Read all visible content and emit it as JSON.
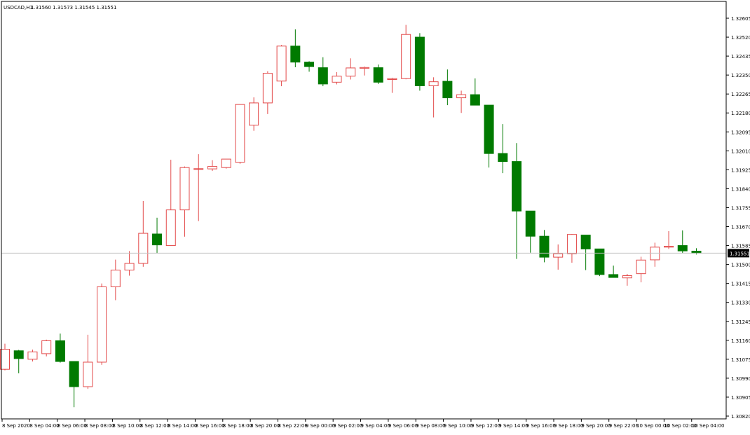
{
  "header": {
    "symbol_timeframe": "USDCAD,H1",
    "ohlc": "1.31560 1.31573 1.31545 1.31551"
  },
  "current_price_label": "1.31551",
  "colors": {
    "bull_outline": "#e34a4a",
    "bear_fill": "#007a00",
    "axis": "#000000",
    "price_line": "#c0c0c0",
    "price_label_bg": "#000000",
    "price_label_text": "#ffffff"
  },
  "chart_data": {
    "type": "candlestick",
    "title": "USDCAD,H1",
    "ylim": [
      1.3082,
      1.26605
    ],
    "y_ticks": [
      "1.32605",
      "1.32520",
      "1.32435",
      "1.32350",
      "1.32265",
      "1.32180",
      "1.32095",
      "1.32010",
      "1.31925",
      "1.31840",
      "1.31755",
      "1.31670",
      "1.31585",
      "1.31500",
      "1.31415",
      "1.31330",
      "1.31245",
      "1.31160",
      "1.31075",
      "1.30990",
      "1.30905",
      "1.30820"
    ],
    "x_ticks": [
      "8 Sep 2020",
      "8 Sep 04:00",
      "8 Sep 06:00",
      "8 Sep 08:00",
      "8 Sep 10:00",
      "8 Sep 12:00",
      "8 Sep 14:00",
      "8 Sep 16:00",
      "8 Sep 18:00",
      "8 Sep 20:00",
      "8 Sep 22:06",
      "9 Sep 00:00",
      "9 Sep 02:00",
      "9 Sep 04:00",
      "9 Sep 06:00",
      "9 Sep 08:00",
      "9 Sep 10:00",
      "9 Sep 12:00",
      "9 Sep 14:00",
      "9 Sep 16:00",
      "9 Sep 18:00",
      "9 Sep 20:00",
      "9 Sep 22:06",
      "10 Sep 00:00",
      "10 Sep 02:00",
      "10 Sep 04:00"
    ],
    "current_price": 1.31551,
    "candles": [
      {
        "o": 1.3103,
        "h": 1.31145,
        "l": 1.31025,
        "c": 1.3112
      },
      {
        "o": 1.31113,
        "h": 1.31117,
        "l": 1.31012,
        "c": 1.31078
      },
      {
        "o": 1.31075,
        "h": 1.31118,
        "l": 1.31065,
        "c": 1.31108
      },
      {
        "o": 1.311,
        "h": 1.31163,
        "l": 1.31088,
        "c": 1.31158
      },
      {
        "o": 1.31158,
        "h": 1.3119,
        "l": 1.3106,
        "c": 1.31065
      },
      {
        "o": 1.31065,
        "h": 1.31063,
        "l": 1.3086,
        "c": 1.30952
      },
      {
        "o": 1.30952,
        "h": 1.31185,
        "l": 1.30942,
        "c": 1.31062
      },
      {
        "o": 1.31062,
        "h": 1.31415,
        "l": 1.3105,
        "c": 1.314
      },
      {
        "o": 1.314,
        "h": 1.31522,
        "l": 1.3134,
        "c": 1.31475
      },
      {
        "o": 1.31475,
        "h": 1.3156,
        "l": 1.3145,
        "c": 1.31505
      },
      {
        "o": 1.31505,
        "h": 1.31785,
        "l": 1.3149,
        "c": 1.3164
      },
      {
        "o": 1.31637,
        "h": 1.3171,
        "l": 1.3155,
        "c": 1.31588
      },
      {
        "o": 1.31585,
        "h": 1.3197,
        "l": 1.31595,
        "c": 1.31745
      },
      {
        "o": 1.31745,
        "h": 1.3194,
        "l": 1.31625,
        "c": 1.31935
      },
      {
        "o": 1.3193,
        "h": 1.31995,
        "l": 1.31695,
        "c": 1.3193
      },
      {
        "o": 1.31929,
        "h": 1.31968,
        "l": 1.3192,
        "c": 1.3194
      },
      {
        "o": 1.31935,
        "h": 1.31955,
        "l": 1.3193,
        "c": 1.31973
      },
      {
        "o": 1.31959,
        "h": 1.32013,
        "l": 1.31952,
        "c": 1.32218
      },
      {
        "o": 1.32125,
        "h": 1.3225,
        "l": 1.321,
        "c": 1.32225
      },
      {
        "o": 1.32225,
        "h": 1.32367,
        "l": 1.32175,
        "c": 1.32358
      },
      {
        "o": 1.32323,
        "h": 1.32485,
        "l": 1.323,
        "c": 1.3248
      },
      {
        "o": 1.3248,
        "h": 1.32555,
        "l": 1.32385,
        "c": 1.32408
      },
      {
        "o": 1.32408,
        "h": 1.32412,
        "l": 1.32365,
        "c": 1.32388
      },
      {
        "o": 1.32383,
        "h": 1.3243,
        "l": 1.323,
        "c": 1.3231
      },
      {
        "o": 1.32318,
        "h": 1.32363,
        "l": 1.32308,
        "c": 1.32345
      },
      {
        "o": 1.32345,
        "h": 1.32425,
        "l": 1.3233,
        "c": 1.32382
      },
      {
        "o": 1.3238,
        "h": 1.32388,
        "l": 1.32348,
        "c": 1.32384
      },
      {
        "o": 1.32383,
        "h": 1.32397,
        "l": 1.3231,
        "c": 1.32318
      },
      {
        "o": 1.3233,
        "h": 1.32338,
        "l": 1.3227,
        "c": 1.32334
      },
      {
        "o": 1.32334,
        "h": 1.32575,
        "l": 1.32331,
        "c": 1.32532
      },
      {
        "o": 1.3252,
        "h": 1.32538,
        "l": 1.3228,
        "c": 1.32302
      },
      {
        "o": 1.32302,
        "h": 1.3234,
        "l": 1.3216,
        "c": 1.3232
      },
      {
        "o": 1.32322,
        "h": 1.32375,
        "l": 1.32215,
        "c": 1.32248
      },
      {
        "o": 1.32248,
        "h": 1.3228,
        "l": 1.3218,
        "c": 1.32262
      },
      {
        "o": 1.32262,
        "h": 1.32335,
        "l": 1.3222,
        "c": 1.32215
      },
      {
        "o": 1.32215,
        "h": 1.32215,
        "l": 1.31935,
        "c": 1.31998
      },
      {
        "o": 1.31998,
        "h": 1.3213,
        "l": 1.3191,
        "c": 1.31962
      },
      {
        "o": 1.31962,
        "h": 1.32045,
        "l": 1.31525,
        "c": 1.3174
      },
      {
        "o": 1.3174,
        "h": 1.3174,
        "l": 1.31553,
        "c": 1.31627
      },
      {
        "o": 1.31627,
        "h": 1.31655,
        "l": 1.3151,
        "c": 1.31533
      },
      {
        "o": 1.31533,
        "h": 1.3159,
        "l": 1.31477,
        "c": 1.31548
      },
      {
        "o": 1.31548,
        "h": 1.31637,
        "l": 1.31508,
        "c": 1.31635
      },
      {
        "o": 1.31632,
        "h": 1.31629,
        "l": 1.31475,
        "c": 1.3157
      },
      {
        "o": 1.3157,
        "h": 1.3157,
        "l": 1.31448,
        "c": 1.31455
      },
      {
        "o": 1.31455,
        "h": 1.31495,
        "l": 1.31445,
        "c": 1.31442
      },
      {
        "o": 1.3144,
        "h": 1.31458,
        "l": 1.31405,
        "c": 1.3145
      },
      {
        "o": 1.31459,
        "h": 1.31535,
        "l": 1.3142,
        "c": 1.3152
      },
      {
        "o": 1.31521,
        "h": 1.31598,
        "l": 1.3149,
        "c": 1.31578
      },
      {
        "o": 1.31578,
        "h": 1.3165,
        "l": 1.3157,
        "c": 1.31582
      },
      {
        "o": 1.31585,
        "h": 1.31653,
        "l": 1.3155,
        "c": 1.31561
      },
      {
        "o": 1.3156,
        "h": 1.31573,
        "l": 1.31545,
        "c": 1.31551
      }
    ]
  }
}
